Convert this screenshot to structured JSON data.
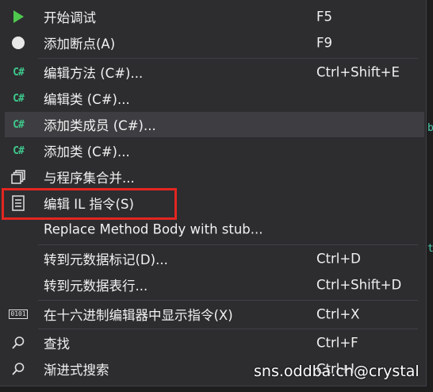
{
  "menu": {
    "items": [
      {
        "label": "开始调试",
        "shortcut": "F5",
        "icon": "play-icon"
      },
      {
        "label": "添加断点(A)",
        "shortcut": "F9",
        "icon": "breakpoint-dot-icon"
      },
      {
        "label": "编辑方法 (C#)...",
        "shortcut": "Ctrl+Shift+E",
        "icon": "csharp-icon"
      },
      {
        "label": "编辑类 (C#)...",
        "shortcut": "",
        "icon": "csharp-icon"
      },
      {
        "label": "添加类成员 (C#)...",
        "shortcut": "",
        "icon": "csharp-icon"
      },
      {
        "label": "添加类 (C#)...",
        "shortcut": "",
        "icon": "csharp-icon"
      },
      {
        "label": "与程序集合并...",
        "shortcut": "",
        "icon": "merge-assemblies-icon"
      },
      {
        "label": "编辑 IL 指令(S)",
        "shortcut": "",
        "icon": "document-lines-icon"
      },
      {
        "label": "Replace Method Body with stub...",
        "shortcut": "",
        "icon": ""
      },
      {
        "label": "转到元数据标记(D)...",
        "shortcut": "Ctrl+D",
        "icon": ""
      },
      {
        "label": "转到元数据表行...",
        "shortcut": "Ctrl+Shift+D",
        "icon": ""
      },
      {
        "label": "在十六进制编辑器中显示指令(X)",
        "shortcut": "Ctrl+X",
        "icon": "binary-0101-icon"
      },
      {
        "label": "查找",
        "shortcut": "Ctrl+F",
        "icon": "search-icon"
      },
      {
        "label": "渐进式搜索",
        "shortcut": "Ctrl+I",
        "icon": "search-icon"
      }
    ],
    "csharp_glyph": "C#",
    "binary_glyph": "0101"
  },
  "watermark": "sns.oddba.ch@crystal",
  "edge_glyphs": [
    "b",
    "t"
  ],
  "colors": {
    "menu_bg": "#2d2d30",
    "hover_bg": "#3e3e42",
    "text": "#f1f1f1",
    "play_green": "#4ec94e",
    "csharp_green": "#3ec98c",
    "highlight_red": "#e32620"
  }
}
